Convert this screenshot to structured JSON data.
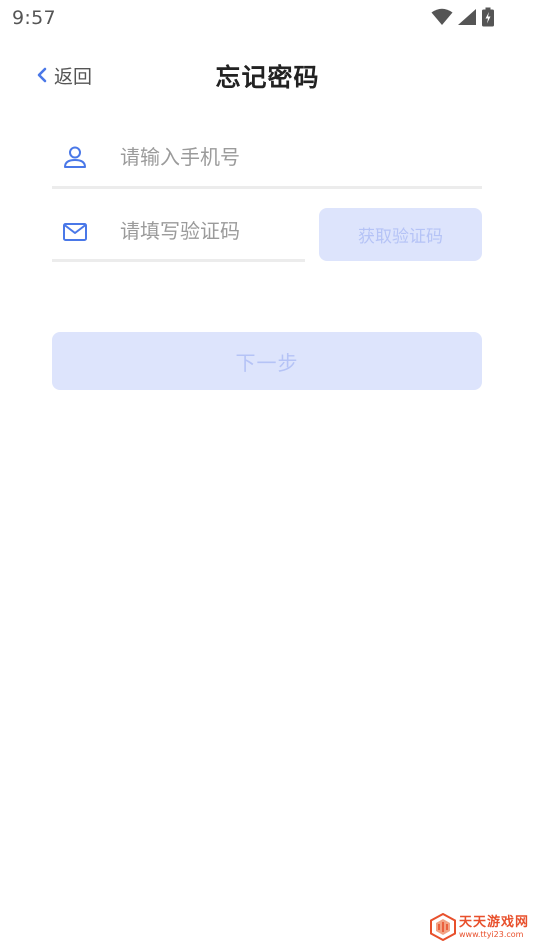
{
  "status_bar": {
    "time": "9:57",
    "icons": [
      "wifi-icon",
      "signal-icon",
      "battery-charging-icon"
    ]
  },
  "header": {
    "back_label": "返回",
    "title": "忘记密码"
  },
  "form": {
    "phone": {
      "icon": "user-icon",
      "placeholder": "请输入手机号",
      "value": ""
    },
    "code": {
      "icon": "mail-icon",
      "placeholder": "请填写验证码",
      "value": ""
    },
    "get_code_label": "获取验证码",
    "next_label": "下一步"
  },
  "watermark": {
    "main": "天天游戏网",
    "sub": "www.ttyi23.com"
  },
  "colors": {
    "accent": "#4a78e8",
    "button_disabled_bg": "#dde4fc",
    "button_disabled_text": "#b5c3f6",
    "divider": "#ececec",
    "placeholder": "#9b9b9b",
    "watermark": "#e8502c"
  }
}
